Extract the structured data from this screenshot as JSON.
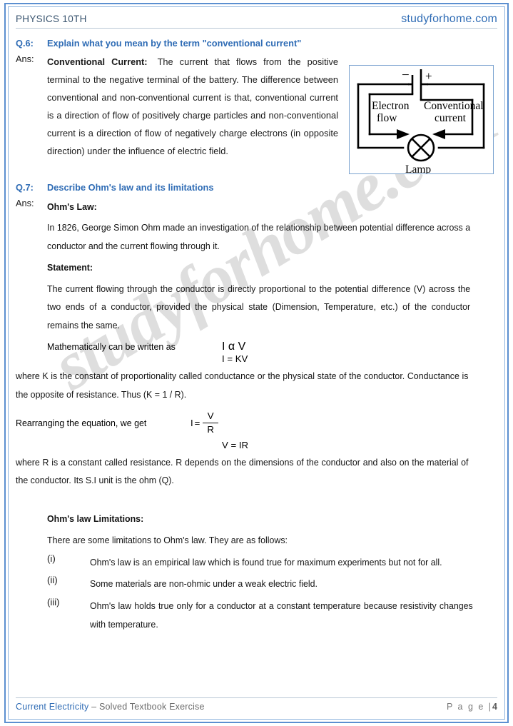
{
  "header": {
    "left_title": "PHYSICS 10TH",
    "site": "studyforhome.com"
  },
  "watermark": "studyforhome.com",
  "q6": {
    "number": "Q.6:",
    "question": "Explain what you mean by the term \"conventional current\"",
    "ans_label": "Ans:",
    "term": "Conventional Current:",
    "body": "The current that flows from the positive terminal to the negative terminal of the battery. The difference between conventional and non-conventional current is that, conventional current is a direction of flow of positively charge particles and non-conventional current is a direction of flow of negatively charge electrons (in opposite direction) under the influence of electric field."
  },
  "diagram": {
    "minus": "−",
    "plus": "+",
    "electron_flow_line1": "Electron",
    "electron_flow_line2": "flow",
    "conventional_line1": "Conventional",
    "conventional_line2": "current",
    "lamp": "Lamp"
  },
  "q7": {
    "number": "Q.7:",
    "question": "Describe Ohm's law and its limitations",
    "ans_label": "Ans:",
    "heading": "Ohm's Law:",
    "intro": "In 1826, George Simon Ohm made an investigation of the relationship between potential difference across a conductor and the current flowing through it.",
    "statement_heading": "Statement:",
    "statement": "The current flowing through the conductor is directly proportional to the potential difference (V) across the two ends of a conductor, provided the physical state (Dimension, Temperature, etc.) of the conductor remains the same.",
    "math_lead": "Mathematically can be written as",
    "eq_proportional": "I α V",
    "eq_ikv": "I  =  KV",
    "where_k": "where K is the constant of proportionality called conductance or the physical state of the conductor. Conductance is the opposite of resistance. Thus (K = 1 / R).",
    "rearrange_lead": "Rearranging the equation, we get",
    "frac_lhs": "I",
    "frac_eq_sign": "=",
    "frac_num": "V",
    "frac_den": "R",
    "eq_vir": "V = IR",
    "where_r": "where R is a constant called resistance. R depends on the dimensions of the conductor and also on the material of the conductor. Its S.I unit is the ohm (Q).",
    "limitations_heading": "Ohm's law Limitations:",
    "limitations_intro": "There are some limitations to Ohm's law. They are as follows:",
    "limitations": [
      {
        "num": "(i)",
        "text": "Ohm's law is an empirical law which is found true for maximum experiments but not for all."
      },
      {
        "num": "(ii)",
        "text": "Some materials are non-ohmic under a weak electric field."
      },
      {
        "num": "(iii)",
        "text": "Ohm's law holds true only for a conductor at a constant temperature because resistivity changes with temperature."
      }
    ]
  },
  "footer": {
    "chapter": "Current Electricity",
    "dash": " – ",
    "subtitle": "Solved Textbook Exercise",
    "page_label": "P a g e  |",
    "page_number": "4"
  },
  "colors": {
    "accent_blue": "#2f6cb5",
    "border_blue": "#5b8fd0",
    "text_dark": "#141414",
    "watermark_gray": "#d9d9d9"
  }
}
